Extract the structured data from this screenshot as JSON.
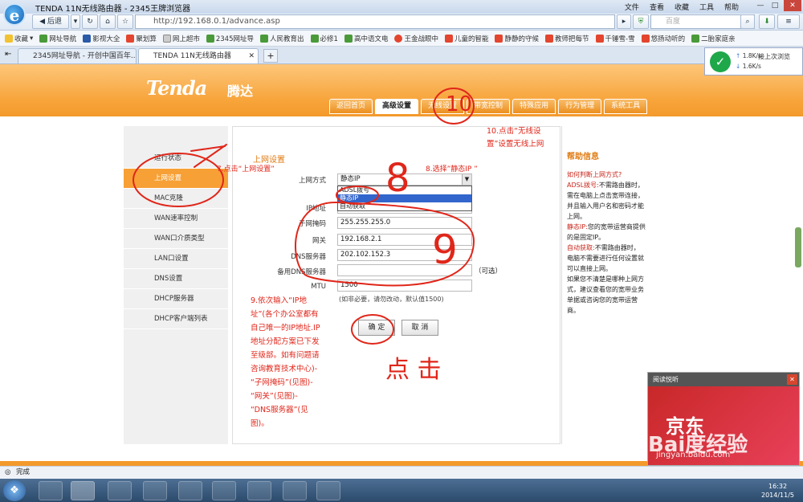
{
  "browser": {
    "window_title": "TENDA 11N无线路由器 - 2345王牌浏览器",
    "menu": [
      "文件",
      "查看",
      "收藏",
      "工具",
      "帮助"
    ],
    "back_label": "后退",
    "url": "http://192.168.0.1/advance.asp",
    "search_placeholder": "百度",
    "bookmarks": [
      "收藏",
      "网址导航",
      "影视大全",
      "聚划算",
      "网上超市",
      "2345网址导",
      "人民教育出",
      "必修1",
      "高中语文电",
      "王金战眼中",
      "儿童的智能",
      "静静的守候",
      "教师把每节",
      "千锤雪-雪",
      "悠扬动听的",
      "二胎家庭亲"
    ],
    "tabs": [
      "2345网址导航 - 开创中国百年...",
      "TENDA 11N无线路由器"
    ],
    "speed_up": "1.8K/s",
    "speed_down": "1.6K/s",
    "right_label": "接上次浏览",
    "status": "完成"
  },
  "router": {
    "brand": "Tenda",
    "brand_cn": "腾达",
    "nav_tabs": [
      "返回首页",
      "高级设置",
      "无线设置",
      "带宽控制",
      "特殊应用",
      "行为管理",
      "系统工具"
    ],
    "sidebar": [
      "运行状态",
      "上网设置",
      "MAC克隆",
      "WAN速率控制",
      "WAN口介质类型",
      "LAN口设置",
      "DNS设置",
      "DHCP服务器",
      "DHCP客户端列表"
    ],
    "form": {
      "section_title": "上网设置",
      "wan_type_label": "上网方式",
      "wan_type_value": "静态IP",
      "dropdown_options": [
        "ADSL拨号",
        "静态IP",
        "自动获取"
      ],
      "ip_label": "IP地址",
      "ip_value": "",
      "mask_label": "子网掩码",
      "mask_value": "255.255.255.0",
      "gateway_label": "网关",
      "gateway_value": "192.168.2.1",
      "dns_label": "DNS服务器",
      "dns_value": "202.102.152.3",
      "dns2_label": "备用DNS服务器",
      "dns2_value": "",
      "dns2_note": "（可选）",
      "mtu_label": "MTU",
      "mtu_value": "1500",
      "mtu_note": "(如非必要，请勿改动，默认值1500)",
      "ok_label": "确 定",
      "cancel_label": "取 消"
    },
    "help": {
      "title": "帮助信息",
      "question": "如何判断上网方式?",
      "lines": [
        {
          "key": "ADSL拨号:",
          "text": "不需路由器时，需在电脑上点击宽带连接，并且输入用户名和密码才能上网。"
        },
        {
          "key": "静态IP:",
          "text": "您的宽带运营商提供的是固定IP。"
        },
        {
          "key": "自动获取:",
          "text": "不需路由器时，电脑不需要进行任何设置就可以直接上网。"
        }
      ],
      "tail": "如果您不清楚是哪种上网方式，建议查看您的宽带业务单据或咨询您的宽带运营商。"
    }
  },
  "annotations": {
    "a7": "7.点击“上网设置”",
    "a8": "8.选择”静态IP ”",
    "a10_line1": "10.点击“无线设",
    "a10_line2": "置”设置无线上网",
    "a9": [
      "9.依次输入“IP地",
      "址”(各个办公室都有",
      "自己唯一的IP地址.IP",
      "地址分配方案已下发",
      "至级部。如有问题请",
      "咨询教育技术中心)-",
      "“子网掩码”(见图)-",
      "“网关”(见图)-",
      "“DNS服务器”(见",
      "图)。"
    ],
    "hand_ten": "10",
    "hand_eight": "8",
    "hand_nine": "9",
    "hand_click": "点 击"
  },
  "ad": {
    "header": "阅读悦听",
    "brand": "京东",
    "watermark": "Bai度经验",
    "watermark_url": "jingyan.baidu.com"
  },
  "taskbar": {
    "time": "16:32",
    "date": "2014/11/5"
  },
  "colors": {
    "orange": "#f39a2c",
    "annotation_red": "#e0261a",
    "link_blue": "#1a4fa8"
  }
}
